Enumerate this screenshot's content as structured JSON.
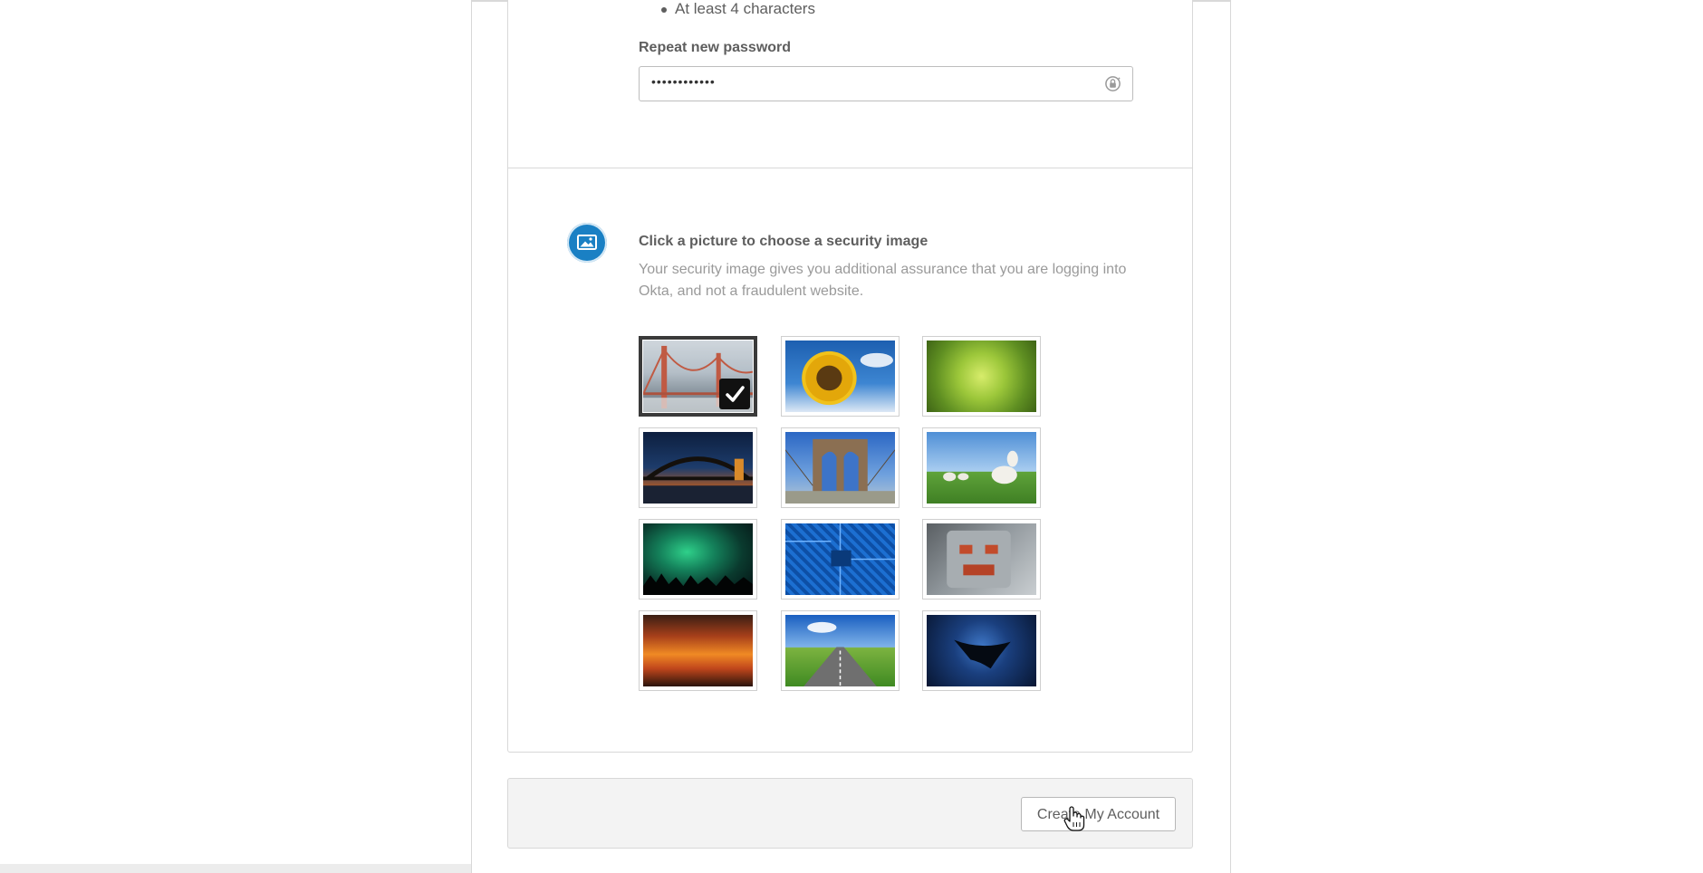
{
  "password_rules": {
    "min_length": "At least 4 characters"
  },
  "repeat_password": {
    "label": "Repeat new password",
    "value": "••••••••••••"
  },
  "security_image": {
    "title": "Click a picture to choose a security image",
    "description": "Your security image gives you additional assurance that you are logging into Okta, and not a fraudulent website.",
    "icon": "image-icon",
    "images": [
      {
        "name": "golden-gate-bridge",
        "selected": true
      },
      {
        "name": "sunflower",
        "selected": false
      },
      {
        "name": "succulent",
        "selected": false
      },
      {
        "name": "harbour-bridge-night",
        "selected": false
      },
      {
        "name": "brooklyn-bridge",
        "selected": false
      },
      {
        "name": "goats-on-grass",
        "selected": false
      },
      {
        "name": "aurora",
        "selected": false
      },
      {
        "name": "circuit-board",
        "selected": false
      },
      {
        "name": "toy-robot",
        "selected": false
      },
      {
        "name": "sunset-clouds",
        "selected": false
      },
      {
        "name": "open-road",
        "selected": false
      },
      {
        "name": "manta-ray",
        "selected": false
      }
    ]
  },
  "footer": {
    "submit_label": "Create My Account"
  },
  "colors": {
    "accent_blue": "#1a80c4",
    "selected_border": "#3a3a3a",
    "footer_bg": "#f3f3f3"
  }
}
